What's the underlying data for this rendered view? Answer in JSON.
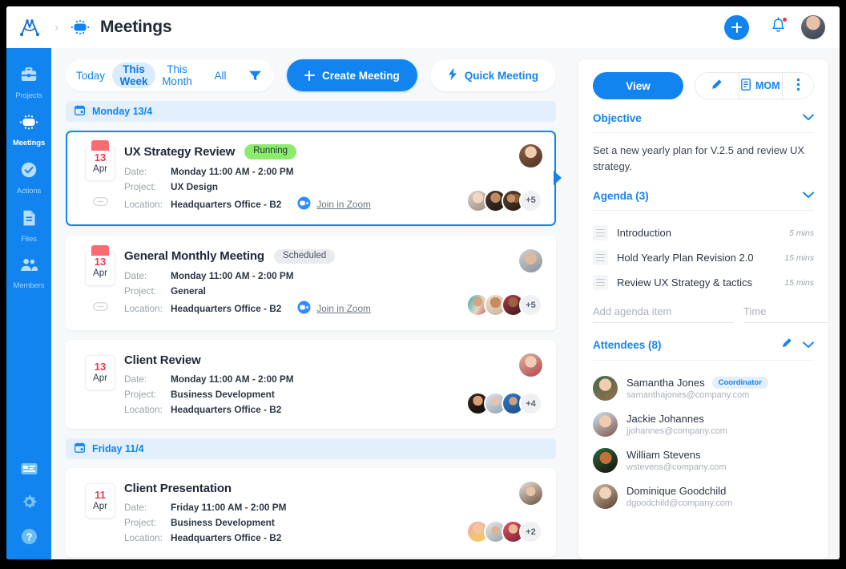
{
  "topbar": {
    "logo_icon": "app-logo-icon",
    "breadcrumb_separator": "›",
    "section_icon": "meeting-table-icon",
    "title": "Meetings",
    "add_label": "+",
    "bell_icon": "notification-bell-icon",
    "avatar_icon": "user-avatar"
  },
  "sidebar": {
    "items": [
      {
        "label": "Projects",
        "icon": "briefcase-icon",
        "active": false
      },
      {
        "label": "Meetings",
        "icon": "meeting-table-icon",
        "active": true
      },
      {
        "label": "Actions",
        "icon": "check-circle-icon",
        "active": false
      },
      {
        "label": "Files",
        "icon": "document-icon",
        "active": false
      },
      {
        "label": "Members",
        "icon": "people-icon",
        "active": false
      }
    ],
    "bottom_items": [
      {
        "icon": "board-layout-icon"
      },
      {
        "icon": "gear-icon"
      },
      {
        "icon": "help-circle-icon"
      }
    ]
  },
  "toolbar": {
    "filters": [
      {
        "label": "Today",
        "active": false
      },
      {
        "label": "This Week",
        "active": true
      },
      {
        "label": "This Month",
        "active": false
      },
      {
        "label": "All",
        "active": false
      }
    ],
    "funnel_icon": "filter-funnel-icon",
    "create_meeting_label": "Create Meeting",
    "quick_meeting_label": "Quick Meeting",
    "quick_meeting_icon": "lightning-bolt-icon",
    "accent_color": "#1184ef"
  },
  "meeting_list": [
    {
      "day_header": "Monday 13/4",
      "day_icon": "calendar-icon",
      "meetings": [
        {
          "selected": true,
          "date_day": "13",
          "date_month": "Apr",
          "has_link_icon": true,
          "title": "UX Strategy Review",
          "status": "Running",
          "status_kind": "running",
          "date_key": "Date:",
          "date_value": "Monday 11:00 AM - 2:00 PM",
          "project_key": "Project:",
          "project_value": "UX Design",
          "location_key": "Location:",
          "location_value": "Headquarters Office - B2",
          "zoom_link": "Join in Zoom",
          "zoom_icon": "zoom-camera-icon",
          "attendee_overflow": "+5"
        },
        {
          "selected": false,
          "date_day": "13",
          "date_month": "Apr",
          "has_link_icon": true,
          "title": "General Monthly Meeting",
          "status": "Scheduled",
          "status_kind": "scheduled",
          "date_key": "Date:",
          "date_value": "Monday 11:00 AM - 2:00 PM",
          "project_key": "Project:",
          "project_value": "General",
          "location_key": "Location:",
          "location_value": "Headquarters Office - B2",
          "zoom_link": "Join in Zoom",
          "zoom_icon": "zoom-camera-icon",
          "attendee_overflow": "+5"
        },
        {
          "selected": false,
          "date_day": "13",
          "date_month": "Apr",
          "has_link_icon": false,
          "title": "Client Review",
          "status": "",
          "status_kind": "none",
          "date_key": "Date:",
          "date_value": "Monday 11:00 AM - 2:00 PM",
          "project_key": "Project:",
          "project_value": "Business Development",
          "location_key": "Location:",
          "location_value": "Headquarters Office - B2",
          "zoom_link": "",
          "zoom_icon": "",
          "attendee_overflow": "+4"
        }
      ]
    },
    {
      "day_header": "Friday 11/4",
      "day_icon": "calendar-icon",
      "meetings": [
        {
          "selected": false,
          "date_day": "11",
          "date_month": "Apr",
          "has_link_icon": false,
          "title": "Client Presentation",
          "status": "",
          "status_kind": "none",
          "date_key": "Date:",
          "date_value": "Friday 11:00 AM - 2:00 PM",
          "project_key": "Project:",
          "project_value": "Business Development",
          "location_key": "Location:",
          "location_value": "Headquarters Office - B2",
          "zoom_link": "",
          "zoom_icon": "",
          "attendee_overflow": "+2"
        }
      ]
    }
  ],
  "panel": {
    "view_label": "View",
    "edit_icon": "pencil-icon",
    "mom_label": "MOM",
    "mom_icon": "document-icon",
    "more_icon": "kebab-menu-icon",
    "objective": {
      "title": "Objective",
      "chevron_icon": "chevron-down-icon",
      "text": "Set a new yearly plan for V.2.5 and review UX strategy."
    },
    "agenda": {
      "title": "Agenda (3)",
      "chevron_icon": "chevron-down-icon",
      "items": [
        {
          "name": "Introduction",
          "time": "5 mins"
        },
        {
          "name": "Hold Yearly Plan Revision 2.0",
          "time": "15 mins"
        },
        {
          "name": "Review UX Strategy & tactics",
          "time": "15 mins"
        }
      ],
      "add_placeholder": "Add agenda item",
      "time_placeholder": "Time"
    },
    "attendees": {
      "title": "Attendees (8)",
      "edit_icon": "pencil-icon",
      "chevron_icon": "chevron-down-icon",
      "list": [
        {
          "name": "Samantha Jones",
          "email": "samanthajones@company.com",
          "role": "Coordinator"
        },
        {
          "name": "Jackie Johannes",
          "email": "jjohannes@company.com",
          "role": ""
        },
        {
          "name": "William Stevens",
          "email": "wstevens@company.com",
          "role": ""
        },
        {
          "name": "Dominique Goodchild",
          "email": "dgoodchild@company.com",
          "role": ""
        }
      ]
    }
  }
}
